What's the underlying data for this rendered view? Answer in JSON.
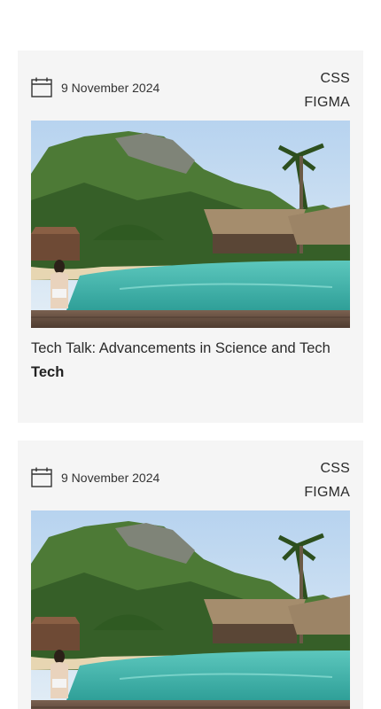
{
  "posts": [
    {
      "date": "9 November 2024",
      "tags": [
        "CSS",
        "FIGMA"
      ],
      "image_alt": "Resort infinity pool with thatched huts and mountains",
      "title": "Tech Talk: Advancements in Science and Tech",
      "category": "Tech"
    },
    {
      "date": "9 November 2024",
      "tags": [
        "CSS",
        "FIGMA"
      ],
      "image_alt": "Resort infinity pool with thatched huts and mountains"
    }
  ],
  "colors": {
    "card_bg": "#f5f5f5",
    "text": "#2b2b2b",
    "pool": "#3fb8b0",
    "sky": "#c9dff0",
    "jungle": "#3f6b2f"
  }
}
